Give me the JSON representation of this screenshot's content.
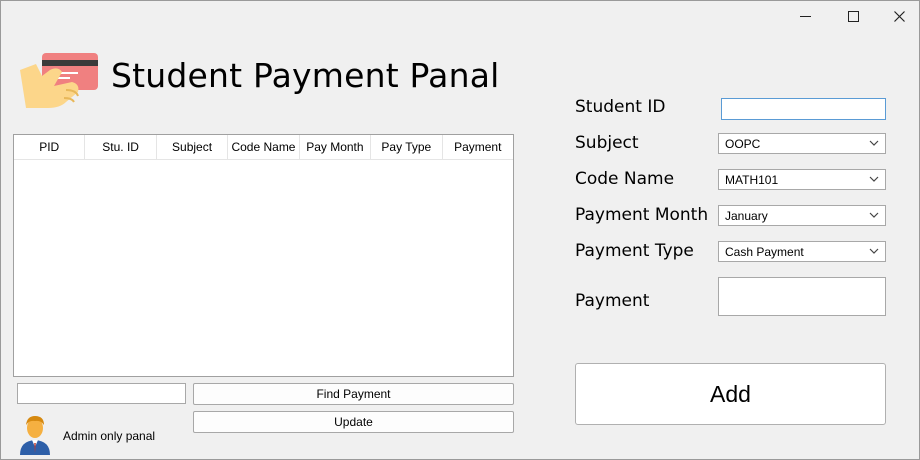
{
  "window": {
    "controls": [
      "minimize",
      "maximize",
      "close"
    ]
  },
  "header": {
    "title": "Student Payment Panal",
    "logo_icon": "credit-card-hand-icon"
  },
  "table": {
    "columns": [
      "PID",
      "Stu. ID",
      "Subject",
      "Code Name",
      "Pay Month",
      "Pay Type",
      "Payment"
    ],
    "rows": []
  },
  "search": {
    "value": "",
    "find_label": "Find Payment",
    "update_label": "Update"
  },
  "admin": {
    "icon": "admin-user-icon",
    "text": "Admin only panal"
  },
  "form": {
    "student_id_label": "Student ID",
    "student_id_value": "",
    "subject_label": "Subject",
    "subject_value": "OOPC",
    "code_name_label": "Code Name",
    "code_name_value": "MATH101",
    "payment_month_label": "Payment Month",
    "payment_month_value": "January",
    "payment_type_label": "Payment Type",
    "payment_type_value": "Cash Payment",
    "payment_label": "Payment",
    "payment_value": "",
    "add_label": "Add"
  },
  "colors": {
    "background": "#f0f0f0",
    "focus_border": "#5a9bd5"
  }
}
